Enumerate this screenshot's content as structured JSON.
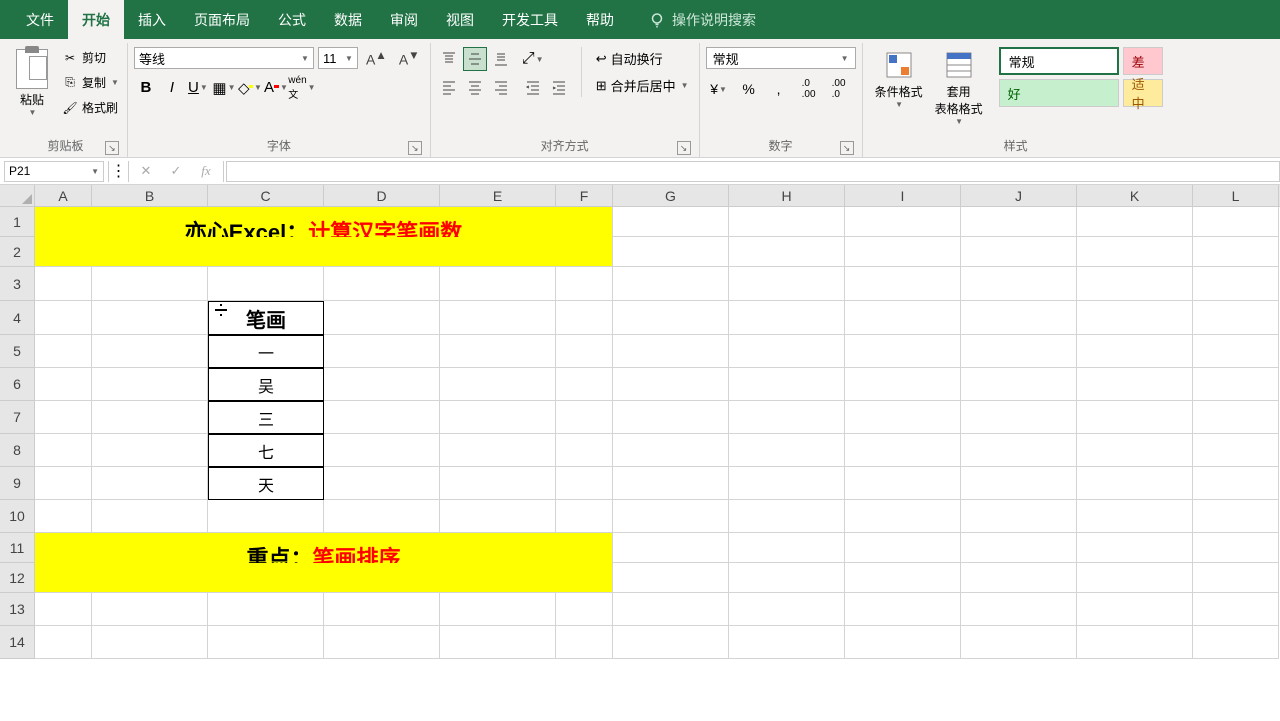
{
  "menu": {
    "file": "文件",
    "home": "开始",
    "insert": "插入",
    "layout": "页面布局",
    "formula": "公式",
    "data": "数据",
    "review": "审阅",
    "view": "视图",
    "dev": "开发工具",
    "help": "帮助",
    "search": "操作说明搜索"
  },
  "ribbon": {
    "clipboard": {
      "label": "剪贴板",
      "paste": "粘贴",
      "cut": "剪切",
      "copy": "复制",
      "painter": "格式刷"
    },
    "font": {
      "label": "字体",
      "name": "等线",
      "size": "11"
    },
    "align": {
      "label": "对齐方式",
      "wrap": "自动换行",
      "merge": "合并后居中"
    },
    "number": {
      "label": "数字",
      "format": "常规"
    },
    "styles": {
      "label": "样式",
      "cond": "条件格式",
      "table": "套用\n表格格式",
      "normal": "常规",
      "bad": "差",
      "good": "好",
      "neutral": "适中"
    }
  },
  "formula_bar": {
    "cell_ref": "P21",
    "value": ""
  },
  "grid": {
    "cols": [
      "A",
      "B",
      "C",
      "D",
      "E",
      "F",
      "G",
      "H",
      "I",
      "J",
      "K",
      "L"
    ],
    "rows": [
      "1",
      "2",
      "3",
      "4",
      "5",
      "6",
      "7",
      "8",
      "9",
      "10",
      "11",
      "12",
      "13",
      "14"
    ],
    "banner1_prefix": "亦心Excel：",
    "banner1_suffix": "计算汉字笔画数",
    "c4": "笔画",
    "c5": "一",
    "c6": "吴",
    "c7": "三",
    "c8": "七",
    "c9": "天",
    "banner2_prefix": "重点：",
    "banner2_suffix": "笔画排序"
  }
}
